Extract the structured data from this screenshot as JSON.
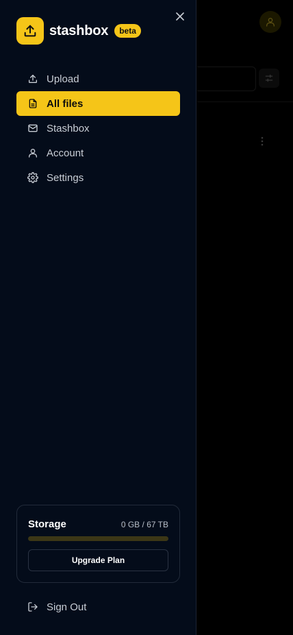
{
  "brand": {
    "name": "stashbox",
    "badge": "beta",
    "logo_icon": "upload-icon"
  },
  "nav": {
    "items": [
      {
        "label": "Upload",
        "icon": "upload-icon",
        "active": false
      },
      {
        "label": "All files",
        "icon": "file-icon",
        "active": true
      },
      {
        "label": "Stashbox",
        "icon": "mail-icon",
        "active": false
      },
      {
        "label": "Account",
        "icon": "user-icon",
        "active": false
      },
      {
        "label": "Settings",
        "icon": "gear-icon",
        "active": false
      }
    ]
  },
  "storage": {
    "title": "Storage",
    "amount": "0 GB / 67 TB",
    "used_fraction": 0,
    "upgrade_label": "Upgrade Plan"
  },
  "signout_label": "Sign Out",
  "colors": {
    "accent": "#f5c518",
    "drawer_bg": "#040c1a",
    "text": "#c9ced6"
  }
}
